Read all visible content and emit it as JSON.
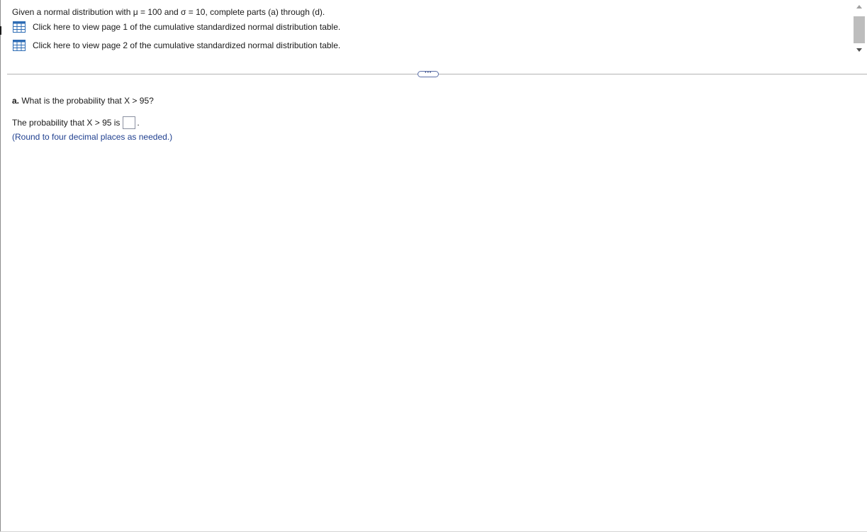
{
  "question": {
    "intro": "Given a normal distribution with μ = 100 and σ = 10, complete parts (a) through (d).",
    "links": [
      {
        "label": "Click here to view page 1 of the cumulative standardized normal distribution table.",
        "icon": "table-icon"
      },
      {
        "label": "Click here to view page 2 of the cumulative standardized normal distribution table.",
        "icon": "table-icon"
      }
    ]
  },
  "divider": {
    "handle_label": "···"
  },
  "part_a": {
    "letter": "a.",
    "question": "What is the probability that X > 95?",
    "answer_prefix": "The probability that X > 95 is",
    "answer_value": "",
    "answer_suffix": ".",
    "note": "(Round to four decimal places as needed.)"
  },
  "colors": {
    "note_text": "#1f3f8f",
    "icon_blue": "#2f6db5",
    "divider_handle": "#5b6fa8"
  }
}
